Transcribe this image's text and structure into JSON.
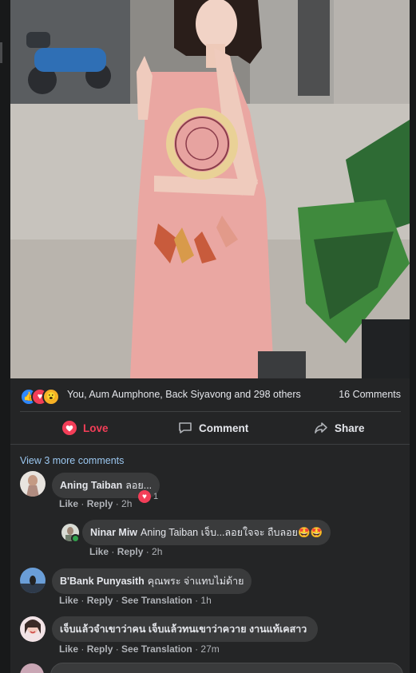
{
  "reactions": {
    "icons": [
      "like-icon",
      "love-icon",
      "wow-icon"
    ],
    "summary": "You, Aum Aumphone, Back Siyavong and 298 others",
    "comments_count": "16 Comments"
  },
  "actions": {
    "love_label": "Love",
    "comment_label": "Comment",
    "share_label": "Share"
  },
  "comments_section": {
    "view_more": "View 3 more comments",
    "comments": [
      {
        "author": "Aning Taiban",
        "text": "ลอย...",
        "like": "Like",
        "reply": "Reply",
        "time": "2h",
        "reaction_count": "1"
      },
      {
        "author": "Ninar Miw",
        "text": "Aning Taiban เจ็บ...ลอยใจจะ ถืบลอย🤩🤩",
        "like": "Like",
        "reply": "Reply",
        "time": "2h"
      },
      {
        "author": "B'Bank Punyasith",
        "text": "คุณพระ จ่าแทบไม่ด้าย",
        "like": "Like",
        "reply": "Reply",
        "see_translation": "See Translation",
        "time": "1h"
      },
      {
        "author": "เจ็บแล้วจำเขาว่าคน เจ็บแล้วทนเขาว่าควาย งานแท้เคสาว",
        "text": "",
        "like": "Like",
        "reply": "Reply",
        "see_translation": "See Translation",
        "time": "27m"
      }
    ]
  },
  "colors": {
    "love": "#f33e58",
    "like": "#2d88ff",
    "wow": "#f7b125",
    "background": "#242526"
  }
}
